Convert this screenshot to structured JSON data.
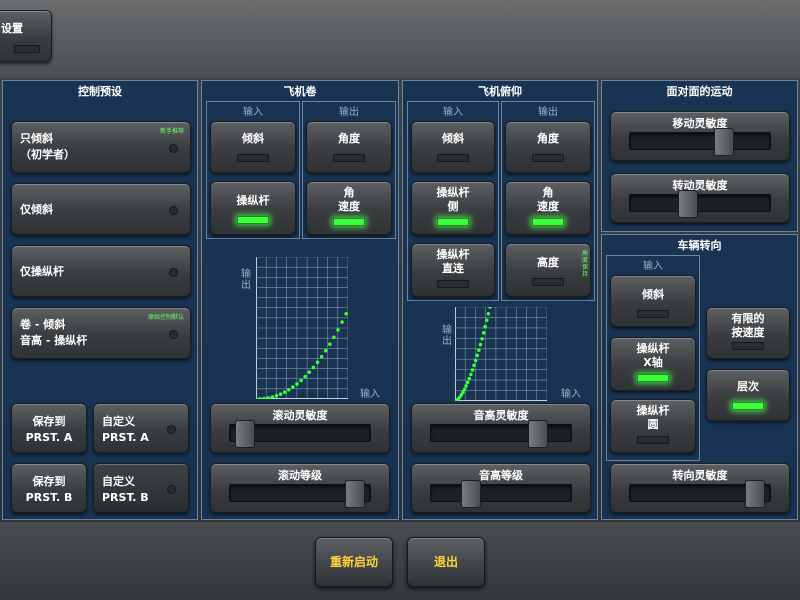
{
  "settings_label": "设置",
  "presets": {
    "title": "控制预设",
    "items": [
      {
        "label": "只倾斜\n（初学者）",
        "badge": "新手推荐"
      },
      {
        "label": "仅倾斜",
        "badge": ""
      },
      {
        "label": "仅操纵杆",
        "badge": ""
      },
      {
        "label": "卷 - 倾斜\n音高 - 操纵杆",
        "badge": "原始控制默认"
      }
    ],
    "save_a": "保存到\nPRST. A",
    "custom_a": "自定义\nPRST. A",
    "save_b": "保存到\nPRST. B",
    "custom_b": "自定义\nPRST. B"
  },
  "roll": {
    "title": "飞机卷",
    "input_label": "输入",
    "output_label": "输出",
    "tilt": "倾斜",
    "angle": "角度",
    "joystick": "操纵杆",
    "angular_velocity": "角\n速度",
    "graph_y": "输出",
    "graph_x": "输入",
    "sensitivity": "滚动灵敏度",
    "level": "滚动等级",
    "sensitivity_value": 0.05,
    "level_value": 0.95
  },
  "pitch": {
    "title": "飞机俯仰",
    "input_label": "输入",
    "output_label": "输出",
    "tilt": "倾斜",
    "angle": "角度",
    "joystick_side": "操纵杆\n侧",
    "angular_velocity": "角\n速度",
    "joystick_direct": "操纵杆\n直连",
    "altitude": "高度",
    "altitude_badge": "高度保持",
    "graph_y": "输出",
    "graph_x": "输入",
    "sensitivity": "音高灵敏度",
    "level": "音高等级",
    "sensitivity_value": 0.8,
    "level_value": 0.25
  },
  "face": {
    "title": "面对面的运动",
    "move_sensitivity": "移动灵敏度",
    "turn_sensitivity": "转动灵敏度",
    "move_value": 0.7,
    "turn_value": 0.4
  },
  "vehicle": {
    "title": "车辆转向",
    "input_label": "输入",
    "tilt": "倾斜",
    "joystick_x": "操纵杆\nX轴",
    "joystick_circle": "操纵杆\n圆",
    "limited_speed": "有限的\n按速度",
    "level": "层次",
    "sensitivity": "转向灵敏度",
    "sensitivity_value": 0.95
  },
  "bottom": {
    "restart": "重新启动",
    "exit": "退出"
  },
  "colors": {
    "accent": "#ffd23a",
    "led_on": "#3aff3a",
    "panel": "#183452"
  }
}
